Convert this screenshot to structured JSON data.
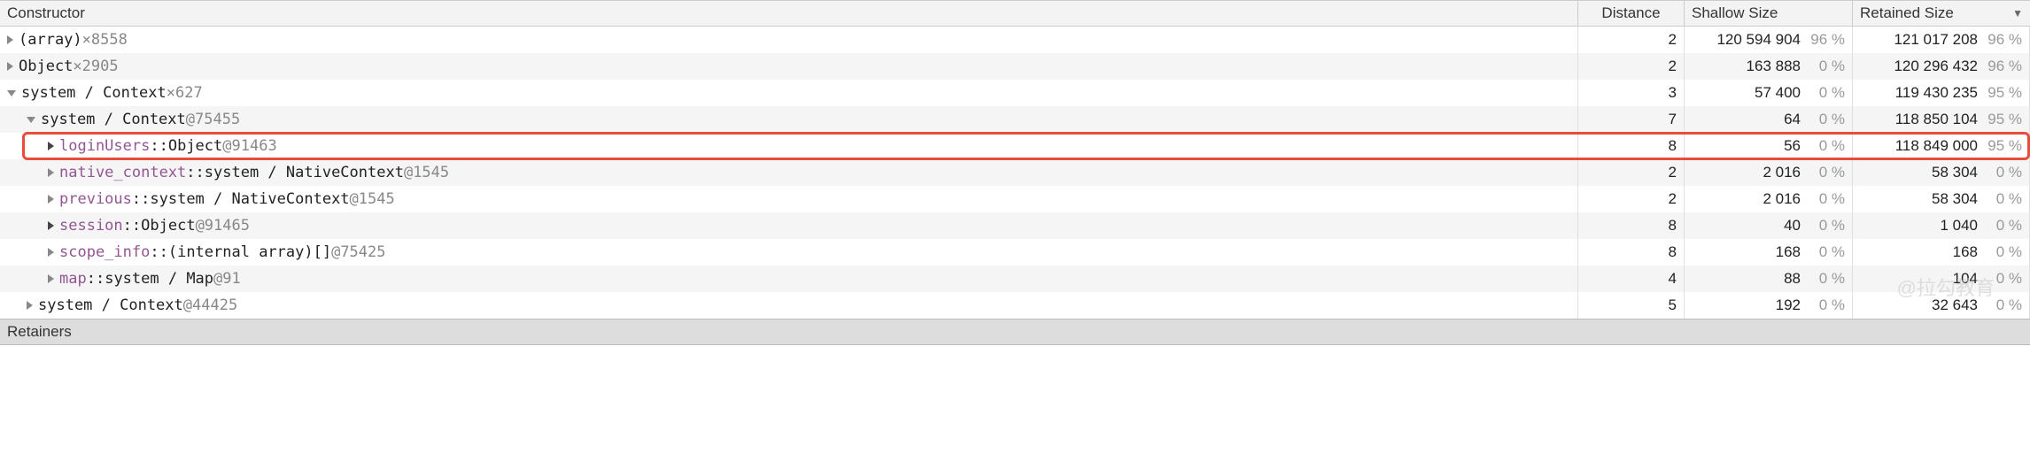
{
  "headers": {
    "constructor": "Constructor",
    "distance": "Distance",
    "shallow": "Shallow Size",
    "retained": "Retained Size"
  },
  "rows": [
    {
      "indent": 0,
      "arrow": "right",
      "name": "(array)",
      "count": "×8558",
      "distance": "2",
      "shallow": "120 594 904",
      "shallow_pct": "96 %",
      "retained": "121 017 208",
      "retained_pct": "96 %",
      "highlight": false
    },
    {
      "indent": 0,
      "arrow": "right",
      "name": "Object",
      "count": "×2905",
      "distance": "2",
      "shallow": "163 888",
      "shallow_pct": "0 %",
      "retained": "120 296 432",
      "retained_pct": "96 %",
      "highlight": false
    },
    {
      "indent": 0,
      "arrow": "down",
      "name": "system / Context",
      "count": "×627",
      "distance": "3",
      "shallow": "57 400",
      "shallow_pct": "0 %",
      "retained": "119 430 235",
      "retained_pct": "95 %",
      "highlight": false
    },
    {
      "indent": 1,
      "arrow": "down",
      "name": "system / Context",
      "objid": "@75455",
      "distance": "7",
      "shallow": "64",
      "shallow_pct": "0 %",
      "retained": "118 850 104",
      "retained_pct": "95 %",
      "highlight": false
    },
    {
      "indent": 2,
      "arrow": "black-right",
      "prop": "loginUsers",
      "sep": "::",
      "cls": "Object",
      "objid": "@91463",
      "distance": "8",
      "shallow": "56",
      "shallow_pct": "0 %",
      "retained": "118 849 000",
      "retained_pct": "95 %",
      "highlight": true
    },
    {
      "indent": 2,
      "arrow": "right",
      "prop": "native_context",
      "sep": "::",
      "cls": "system / NativeContext",
      "objid": "@1545",
      "distance": "2",
      "shallow": "2 016",
      "shallow_pct": "0 %",
      "retained": "58 304",
      "retained_pct": "0 %",
      "highlight": false
    },
    {
      "indent": 2,
      "arrow": "right",
      "prop": "previous",
      "sep": "::",
      "cls": "system / NativeContext",
      "objid": "@1545",
      "distance": "2",
      "shallow": "2 016",
      "shallow_pct": "0 %",
      "retained": "58 304",
      "retained_pct": "0 %",
      "highlight": false
    },
    {
      "indent": 2,
      "arrow": "black-right",
      "prop": "session",
      "sep": "::",
      "cls": "Object",
      "objid": "@91465",
      "distance": "8",
      "shallow": "40",
      "shallow_pct": "0 %",
      "retained": "1 040",
      "retained_pct": "0 %",
      "highlight": false
    },
    {
      "indent": 2,
      "arrow": "right",
      "prop": "scope_info",
      "sep": "::",
      "cls": "(internal array)[]",
      "objid": "@75425",
      "distance": "8",
      "shallow": "168",
      "shallow_pct": "0 %",
      "retained": "168",
      "retained_pct": "0 %",
      "highlight": false
    },
    {
      "indent": 2,
      "arrow": "right",
      "prop": "map",
      "sep": "::",
      "cls": "system / Map",
      "objid": "@91",
      "distance": "4",
      "shallow": "88",
      "shallow_pct": "0 %",
      "retained": "104",
      "retained_pct": "0 %",
      "highlight": false
    },
    {
      "indent": 1,
      "arrow": "right",
      "name": "system / Context",
      "objid": "@44425",
      "distance": "5",
      "shallow": "192",
      "shallow_pct": "0 %",
      "retained": "32 643",
      "retained_pct": "0 %",
      "highlight": false
    }
  ],
  "retainers_label": "Retainers",
  "watermark": "@拉勾教育"
}
